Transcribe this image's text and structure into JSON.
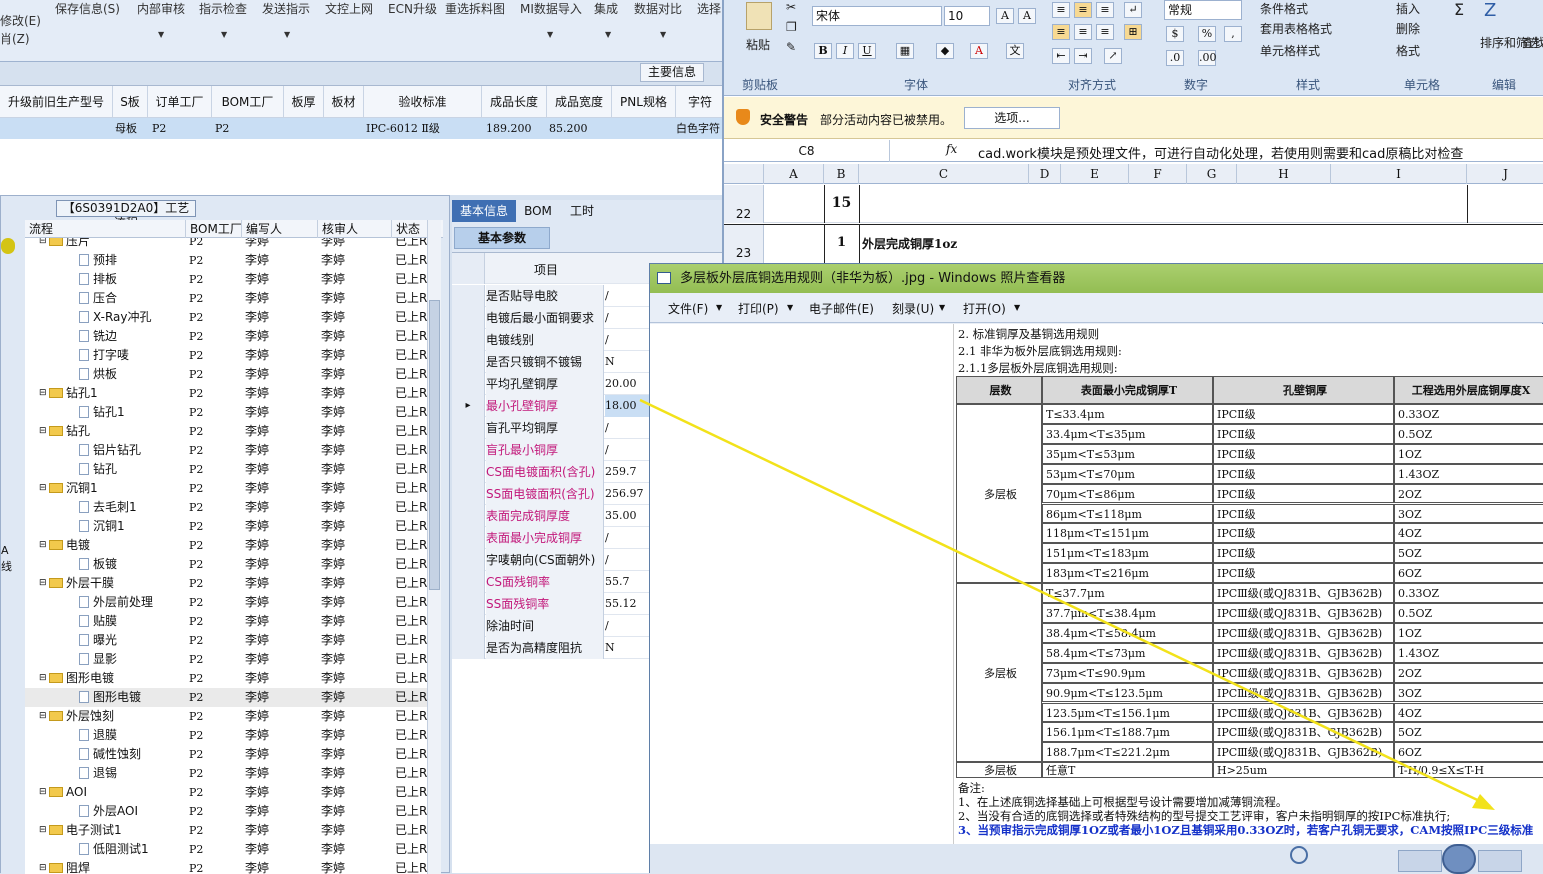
{
  "app": {
    "toolbar_row1": [
      "保存信息(S)",
      "内部审核",
      "指示检查",
      "发送指示",
      "文控上网",
      "ECN升级",
      "重选拆料图",
      "MI数据导入",
      "集成",
      "数据对比",
      "选择"
    ],
    "left_edge_1": "修改(E)",
    "left_edge_2": "肖(Z)",
    "main_info": "主要信息",
    "grid_headers": [
      "升级前旧生产型号",
      "S板",
      "订单工厂",
      "BOM工厂",
      "板厚",
      "板材",
      "验收标准",
      "成品长度",
      "成品宽度",
      "PNL规格",
      "字符"
    ],
    "grid_row": {
      "c1": "母板",
      "c2": "P2",
      "c3": "P2",
      "c4": "IPC-6012 Ⅱ级",
      "c5": "189.200",
      "c6": "85.200",
      "c7": "白色字符"
    }
  },
  "process": {
    "title": "【6S0391D2A0】工艺流程",
    "headers": [
      "流程",
      "BOM工厂",
      "编写人",
      "核审人",
      "状态"
    ],
    "rows": [
      {
        "name": "压片",
        "t": "folder",
        "f": "P2",
        "w": "李婷",
        "r": "李婷",
        "s": "已上R"
      },
      {
        "name": "预排",
        "t": "doc",
        "f": "P2",
        "w": "李婷",
        "r": "李婷",
        "s": "已上R"
      },
      {
        "name": "排板",
        "t": "doc",
        "f": "P2",
        "w": "李婷",
        "r": "李婷",
        "s": "已上R"
      },
      {
        "name": "压合",
        "t": "doc",
        "f": "P2",
        "w": "李婷",
        "r": "李婷",
        "s": "已上R"
      },
      {
        "name": "X-Ray冲孔",
        "t": "doc",
        "f": "P2",
        "w": "李婷",
        "r": "李婷",
        "s": "已上R"
      },
      {
        "name": "铣边",
        "t": "doc",
        "f": "P2",
        "w": "李婷",
        "r": "李婷",
        "s": "已上R"
      },
      {
        "name": "打字唛",
        "t": "doc",
        "f": "P2",
        "w": "李婷",
        "r": "李婷",
        "s": "已上R"
      },
      {
        "name": "烘板",
        "t": "doc",
        "f": "P2",
        "w": "李婷",
        "r": "李婷",
        "s": "已上R"
      },
      {
        "name": "钻孔1",
        "t": "folder",
        "f": "P2",
        "w": "李婷",
        "r": "李婷",
        "s": "已上R"
      },
      {
        "name": "钻孔1",
        "t": "doc",
        "f": "P2",
        "w": "李婷",
        "r": "李婷",
        "s": "已上R"
      },
      {
        "name": "钻孔",
        "t": "folder",
        "f": "P2",
        "w": "李婷",
        "r": "李婷",
        "s": "已上R"
      },
      {
        "name": "铝片钻孔",
        "t": "doc",
        "f": "P2",
        "w": "李婷",
        "r": "李婷",
        "s": "已上R"
      },
      {
        "name": "钻孔",
        "t": "doc",
        "f": "P2",
        "w": "李婷",
        "r": "李婷",
        "s": "已上R"
      },
      {
        "name": "沉铜1",
        "t": "folder",
        "f": "P2",
        "w": "李婷",
        "r": "李婷",
        "s": "已上R"
      },
      {
        "name": "去毛刺1",
        "t": "doc",
        "f": "P2",
        "w": "李婷",
        "r": "李婷",
        "s": "已上R"
      },
      {
        "name": "沉铜1",
        "t": "doc",
        "f": "P2",
        "w": "李婷",
        "r": "李婷",
        "s": "已上R"
      },
      {
        "name": "电镀",
        "t": "folder",
        "f": "P2",
        "w": "李婷",
        "r": "李婷",
        "s": "已上R"
      },
      {
        "name": "板镀",
        "t": "doc",
        "f": "P2",
        "w": "李婷",
        "r": "李婷",
        "s": "已上R"
      },
      {
        "name": "外层干膜",
        "t": "folder",
        "f": "P2",
        "w": "李婷",
        "r": "李婷",
        "s": "已上R"
      },
      {
        "name": "外层前处理",
        "t": "doc",
        "f": "P2",
        "w": "李婷",
        "r": "李婷",
        "s": "已上R"
      },
      {
        "name": "贴膜",
        "t": "doc",
        "f": "P2",
        "w": "李婷",
        "r": "李婷",
        "s": "已上R"
      },
      {
        "name": "曝光",
        "t": "doc",
        "f": "P2",
        "w": "李婷",
        "r": "李婷",
        "s": "已上R"
      },
      {
        "name": "显影",
        "t": "doc",
        "f": "P2",
        "w": "李婷",
        "r": "李婷",
        "s": "已上R"
      },
      {
        "name": "图形电镀",
        "t": "folder",
        "f": "P2",
        "w": "李婷",
        "r": "李婷",
        "s": "已上R"
      },
      {
        "name": "图形电镀",
        "t": "doc",
        "f": "P2",
        "w": "李婷",
        "r": "李婷",
        "s": "已上R"
      },
      {
        "name": "外层蚀刻",
        "t": "folder",
        "f": "P2",
        "w": "李婷",
        "r": "李婷",
        "s": "已上R"
      },
      {
        "name": "退膜",
        "t": "doc",
        "f": "P2",
        "w": "李婷",
        "r": "李婷",
        "s": "已上R"
      },
      {
        "name": "碱性蚀刻",
        "t": "doc",
        "f": "P2",
        "w": "李婷",
        "r": "李婷",
        "s": "已上R"
      },
      {
        "name": "退锡",
        "t": "doc",
        "f": "P2",
        "w": "李婷",
        "r": "李婷",
        "s": "已上R"
      },
      {
        "name": "AOI",
        "t": "folder",
        "f": "P2",
        "w": "李婷",
        "r": "李婷",
        "s": "已上R"
      },
      {
        "name": "外层AOI",
        "t": "doc",
        "f": "P2",
        "w": "李婷",
        "r": "李婷",
        "s": "已上R"
      },
      {
        "name": "电子测试1",
        "t": "folder",
        "f": "P2",
        "w": "李婷",
        "r": "李婷",
        "s": "已上R"
      },
      {
        "name": "低阻测试1",
        "t": "doc",
        "f": "P2",
        "w": "李婷",
        "r": "李婷",
        "s": "已上R"
      },
      {
        "name": "阻焊",
        "t": "folder",
        "f": "P2",
        "w": "李婷",
        "r": "李婷",
        "s": "已上R"
      }
    ],
    "left_letter_1": "A",
    "left_letter_2": "线"
  },
  "basic": {
    "tabs": [
      "基本信息",
      "BOM",
      "工时"
    ],
    "param_tab": "基本参数",
    "col_header": "项目",
    "params": [
      {
        "label": "是否贴导电胶",
        "value": "/",
        "pink": false
      },
      {
        "label": "电镀后最小面铜要求",
        "value": "/",
        "pink": false
      },
      {
        "label": "电镀线别",
        "value": "/",
        "pink": false
      },
      {
        "label": "是否只镀铜不镀锡",
        "value": "N",
        "pink": false
      },
      {
        "label": "平均孔壁铜厚",
        "value": "20.00",
        "pink": false
      },
      {
        "label": "最小孔壁铜厚",
        "value": "18.00",
        "pink": true
      },
      {
        "label": "盲孔平均铜厚",
        "value": "/",
        "pink": false
      },
      {
        "label": "盲孔最小铜厚",
        "value": "/",
        "pink": true
      },
      {
        "label": "CS面电镀面积(含孔)",
        "value": "259.7",
        "pink": true
      },
      {
        "label": "SS面电镀面积(含孔)",
        "value": "256.97",
        "pink": true
      },
      {
        "label": "表面完成铜厚度",
        "value": "35.00",
        "pink": true
      },
      {
        "label": "表面最小完成铜厚",
        "value": "/",
        "pink": true
      },
      {
        "label": "字唛朝向(CS面朝外)",
        "value": "/",
        "pink": false
      },
      {
        "label": "CS面残铜率",
        "value": "55.7",
        "pink": true
      },
      {
        "label": "SS面残铜率",
        "value": "55.12",
        "pink": true
      },
      {
        "label": "除油时间",
        "value": "/",
        "pink": false
      },
      {
        "label": "是否为高精度阻抗",
        "value": "N",
        "pink": false
      }
    ]
  },
  "excel": {
    "paste": "粘贴",
    "font_name": "宋体",
    "font_size": "10",
    "number_format": "常规",
    "cond_format": "条件格式",
    "table_format": "套用表格格式",
    "cell_style": "单元格样式",
    "insert": "插入",
    "delete": "删除",
    "format": "格式",
    "sort_filter": "排序和筛选",
    "find_select": "查找和选择",
    "groups": [
      "剪贴板",
      "字体",
      "对齐方式",
      "数字",
      "样式",
      "单元格",
      "编辑"
    ],
    "security_title": "安全警告",
    "security_msg": "部分活动内容已被禁用。",
    "options_btn": "选项...",
    "cell_ref": "C8",
    "fx": "fx",
    "formula": "cad.work模块是预处理文件，可进行自动化处理，若使用则需要和cad原稿比对检查",
    "columns": [
      "A",
      "B",
      "C",
      "D",
      "E",
      "F",
      "G",
      "H",
      "I",
      "J"
    ],
    "row22": {
      "num": "22",
      "b": "15",
      "c": ""
    },
    "row23": {
      "num": "23",
      "b": "1",
      "c": "外层完成铜厚1oz"
    }
  },
  "viewer": {
    "title": "多层板外层底铜选用规则（非华为板）.jpg - Windows 照片查看器",
    "menu": [
      "文件(F)",
      "打印(P)",
      "电子邮件(E)",
      "刻录(U)",
      "打开(O)"
    ],
    "doc_line1": "2. 标准铜厚及基铜选用规则",
    "doc_line2": "2.1 非华为板外层底铜选用规则:",
    "doc_line3": "2.1.1多层板外层底铜选用规则:",
    "headers": [
      "层数",
      "表面最小完成铜厚T",
      "孔壁铜厚",
      "工程选用外层底铜厚度X"
    ],
    "group1_label": "多层板",
    "group1": [
      [
        "T≤33.4μm",
        "IPCⅡ级",
        "0.33OZ"
      ],
      [
        "33.4μm<T≤35μm",
        "IPCⅡ级",
        "0.5OZ"
      ],
      [
        "35μm<T≤53μm",
        "IPCⅡ级",
        "1OZ"
      ],
      [
        "53μm<T≤70μm",
        "IPCⅡ级",
        "1.43OZ"
      ],
      [
        "70μm<T≤86μm",
        "IPCⅡ级",
        "2OZ"
      ],
      [
        "86μm<T≤118μm",
        "IPCⅡ级",
        "3OZ"
      ],
      [
        "118μm<T≤151μm",
        "IPCⅡ级",
        "4OZ"
      ],
      [
        "151μm<T≤183μm",
        "IPCⅡ级",
        "5OZ"
      ],
      [
        "183μm<T≤216μm",
        "IPCⅡ级",
        "6OZ"
      ]
    ],
    "group2_label": "多层板",
    "group2": [
      [
        "T≤37.7μm",
        "IPCⅢ级(或QJ831B、GJB362B)",
        "0.33OZ"
      ],
      [
        "37.7μm<T≤38.4μm",
        "IPCⅢ级(或QJ831B、GJB362B)",
        "0.5OZ"
      ],
      [
        "38.4μm<T≤58.4μm",
        "IPCⅢ级(或QJ831B、GJB362B)",
        "1OZ"
      ],
      [
        "58.4μm<T≤73μm",
        "IPCⅢ级(或QJ831B、GJB362B)",
        "1.43OZ"
      ],
      [
        "73μm<T≤90.9μm",
        "IPCⅢ级(或QJ831B、GJB362B)",
        "2OZ"
      ],
      [
        "90.9μm<T≤123.5μm",
        "IPCⅢ级(或QJ831B、GJB362B)",
        "3OZ"
      ],
      [
        "123.5μm<T≤156.1μm",
        "IPCⅢ级(或QJ831B、GJB362B)",
        "4OZ"
      ],
      [
        "156.1μm<T≤188.7μm",
        "IPCⅢ级(或QJ831B、GJB362B)",
        "5OZ"
      ],
      [
        "188.7μm<T≤221.2μm",
        "IPCⅢ级(或QJ831B、GJB362B)",
        "6OZ"
      ]
    ],
    "group3": [
      "多层板",
      "任意T",
      "H>25um",
      "T-H/0.9≤X≤T-H"
    ],
    "note_title": "备注:",
    "note1": "1、在上述底铜选择基础上可根据型号设计需要增加减薄铜流程。",
    "note2": "2、当没有合适的底铜选择或者特殊结构的型号提交工艺评审，客户未指明铜厚的按IPC标准执行;",
    "note3": "3、当预审指示完成铜厚1OZ或者最小1OZ且基铜采用0.33OZ时，若客户孔铜无要求，CAM按照IPC三级标准"
  }
}
